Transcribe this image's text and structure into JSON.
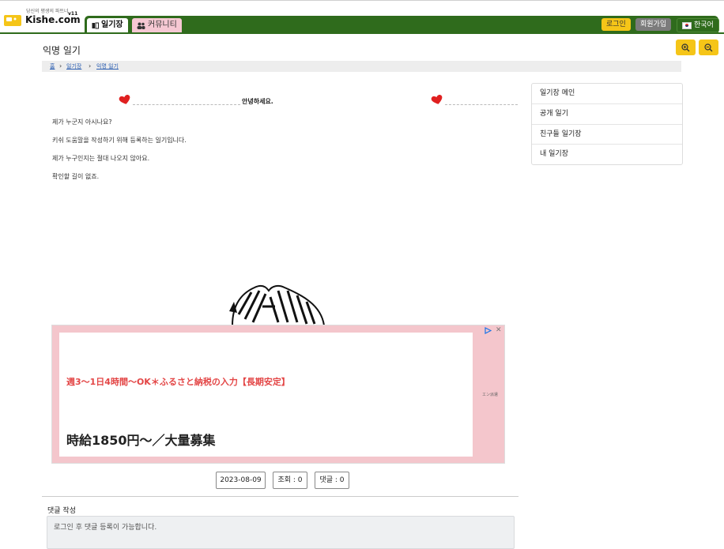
{
  "header": {
    "logo_tagline": "당신의 평생의 파트너",
    "logo_text": "Kishe.com",
    "logo_version": "v11",
    "tabs": [
      {
        "label": "일기장",
        "icon": "book-icon"
      },
      {
        "label": "커뮤니티",
        "icon": "users-icon"
      }
    ],
    "login_label": "로그인",
    "signup_label": "회원가입",
    "language_label": "한국어"
  },
  "page": {
    "title": "익명 일기",
    "breadcrumb": [
      "홈",
      "일기장",
      "익명 일기"
    ]
  },
  "diary": {
    "title": "안녕하세요.",
    "lines": [
      "제가 누군지 아시나요?",
      "키쉬 도움말을 작성하기 위해 등록하는 일기입니다.",
      "제가 누구인지는 절대 나오지 않아요.",
      "확인할 길이 없죠."
    ],
    "date": "2023-08-09",
    "views": "조회 : 0",
    "comments": "댓글 : 0"
  },
  "sidebar": {
    "items": [
      "일기장 메인",
      "공개 일기",
      "친구들 일기장",
      "내 일기장"
    ]
  },
  "ad": {
    "line1": "週3〜1日4時間〜OK＊ふるさと納税の入力【長期安定】",
    "line2": "時給1850円〜／大量募集",
    "brand": "エン派遣"
  },
  "comment": {
    "label": "댓글 작성",
    "placeholder": "로그인 후 댓글 등록이 가능합니다."
  },
  "colors": {
    "nav_green": "#2f6b1c",
    "accent_yellow": "#f5c518",
    "community_pink": "#f6c8d3",
    "heart_red": "#e02020",
    "ad_pink": "#f4c6cc",
    "ad_text_red": "#e34646"
  }
}
